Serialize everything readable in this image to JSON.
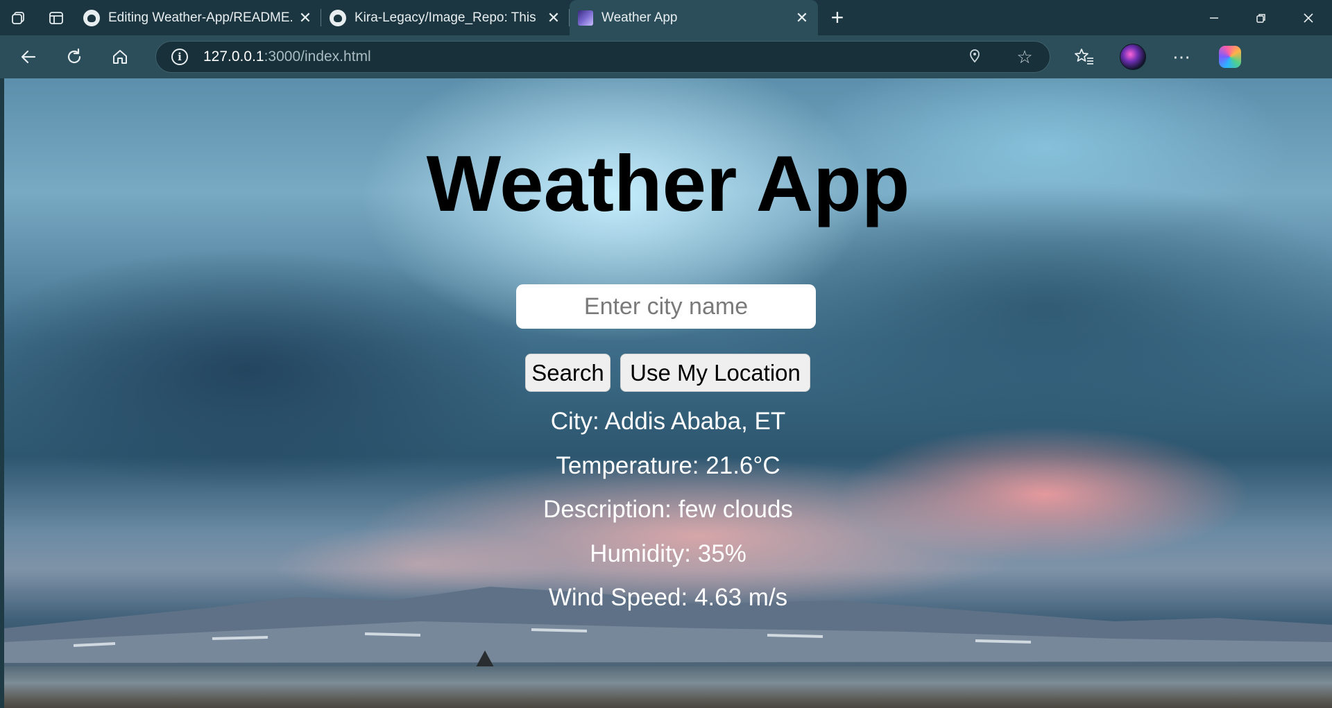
{
  "browser": {
    "tabs": [
      {
        "title": "Editing Weather-App/README.md",
        "favicon": "github-icon",
        "active": false
      },
      {
        "title": "Kira-Legacy/Image_Repo: This is my image repo",
        "favicon": "github-icon",
        "active": false
      },
      {
        "title": "Weather App",
        "favicon": "weather-app-icon",
        "active": true
      }
    ],
    "address": {
      "host": "127.0.0.1",
      "rest": ":3000/index.html"
    }
  },
  "page": {
    "title": "Weather App",
    "search": {
      "placeholder": "Enter city name",
      "value": ""
    },
    "buttons": {
      "search": "Search",
      "location": "Use My Location"
    },
    "weather": {
      "city": "City: Addis Ababa, ET",
      "temperature": "Temperature: 21.6°C",
      "description": "Description: few clouds",
      "humidity": "Humidity: 35%",
      "wind": "Wind Speed: 4.63 m/s"
    }
  },
  "colors": {
    "tabbar_bg": "#1b3640",
    "toolbar_bg": "#2b4e5a",
    "title_color": "#000000",
    "info_text": "#ffffff"
  }
}
